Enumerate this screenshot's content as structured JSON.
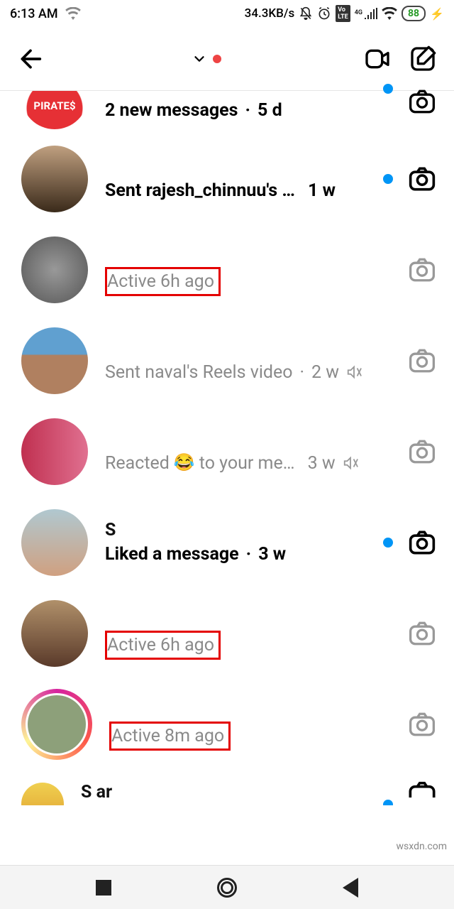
{
  "statusBar": {
    "time": "6:13 AM",
    "rate": "34.3KB/s",
    "battery": "88"
  },
  "header": {
    "title": ""
  },
  "chats": [
    {
      "name": "",
      "message": "2 new messages",
      "time": "5 d",
      "bold": true,
      "unread": true
    },
    {
      "name": "",
      "message": "Sent rajesh_chinnuu's …",
      "time": "1 w",
      "bold": true,
      "unread": true
    },
    {
      "name": "",
      "message": "Active 6h ago",
      "time": "",
      "bold": false,
      "highlighted": true
    },
    {
      "name": "",
      "message": "Sent naval's Reels video",
      "time": "2 w",
      "bold": false,
      "muted": true
    },
    {
      "name": "",
      "message_pre": "Reacted ",
      "message_post": " to your me…",
      "time": "3 w",
      "bold": false,
      "muted": true,
      "emoji": "😂"
    },
    {
      "name": "S",
      "message": "Liked a message",
      "time": "3 w",
      "bold": true,
      "unread": true
    },
    {
      "name": "",
      "message": "Active 6h ago",
      "time": "",
      "bold": false,
      "highlighted": true
    },
    {
      "name": "",
      "message": "Active 8m ago",
      "time": "",
      "bold": false,
      "highlighted": true,
      "story": true
    },
    {
      "name": "S                                ar",
      "message": "",
      "time": "",
      "bold": false,
      "unread": true
    }
  ],
  "watermark": "wsxdn.com"
}
